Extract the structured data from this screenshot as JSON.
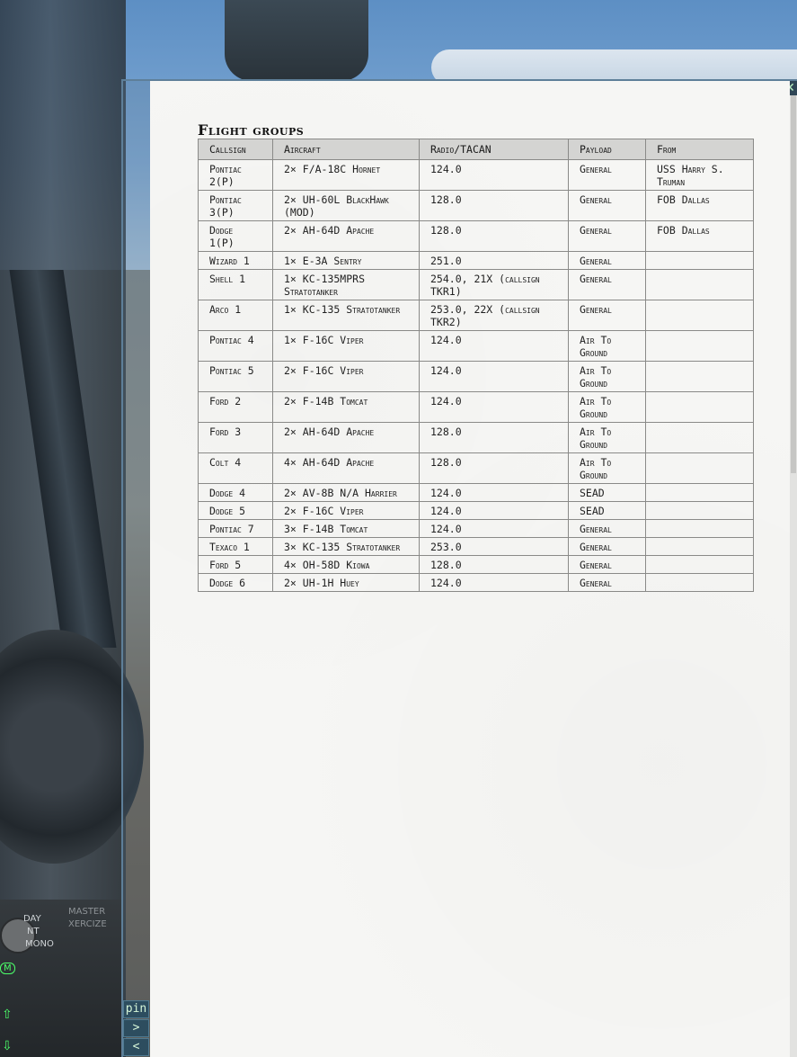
{
  "window": {
    "close_label": "✕",
    "side_buttons": [
      "pin",
      ">",
      "<"
    ]
  },
  "cockpit": {
    "panel_labels": [
      "DAY",
      "NT",
      "MONO"
    ],
    "master_label": "MASTER",
    "exercise_label": "XERCIZE",
    "indicator": "M"
  },
  "section_title": "Flight groups",
  "table": {
    "headers": [
      "Callsign",
      "Aircraft",
      "Radio/TACAN",
      "Payload",
      "From"
    ],
    "rows": [
      {
        "callsign": "Pontiac 2(P)",
        "aircraft": "2× F/A-18C Hornet",
        "radio": "124.0",
        "payload": "General",
        "from": "USS Harry S. Truman"
      },
      {
        "callsign": "Pontiac 3(P)",
        "aircraft": "2× UH-60L BlackHawk (MOD)",
        "radio": "128.0",
        "payload": "General",
        "from": "FOB Dallas"
      },
      {
        "callsign": "Dodge 1(P)",
        "aircraft": "2× AH-64D Apache",
        "radio": "128.0",
        "payload": "General",
        "from": "FOB Dallas"
      },
      {
        "callsign": "Wizard 1",
        "aircraft": "1× E-3A Sentry",
        "radio": "251.0",
        "payload": "General",
        "from": ""
      },
      {
        "callsign": "Shell 1",
        "aircraft": "1× KC-135MPRS Stratotanker",
        "radio": "254.0, 21X (callsign TKR1)",
        "payload": "General",
        "from": ""
      },
      {
        "callsign": "Arco 1",
        "aircraft": "1× KC-135 Stratotanker",
        "radio": "253.0, 22X (callsign TKR2)",
        "payload": "General",
        "from": ""
      },
      {
        "callsign": "Pontiac 4",
        "aircraft": "1× F-16C Viper",
        "radio": "124.0",
        "payload": "Air To Ground",
        "from": ""
      },
      {
        "callsign": "Pontiac 5",
        "aircraft": "2× F-16C Viper",
        "radio": "124.0",
        "payload": "Air To Ground",
        "from": ""
      },
      {
        "callsign": "Ford 2",
        "aircraft": "2× F-14B Tomcat",
        "radio": "124.0",
        "payload": "Air To Ground",
        "from": ""
      },
      {
        "callsign": "Ford 3",
        "aircraft": "2× AH-64D Apache",
        "radio": "128.0",
        "payload": "Air To Ground",
        "from": ""
      },
      {
        "callsign": "Colt 4",
        "aircraft": "4× AH-64D Apache",
        "radio": "128.0",
        "payload": "Air To Ground",
        "from": ""
      },
      {
        "callsign": "Dodge 4",
        "aircraft": "2× AV-8B N/A Harrier",
        "radio": "124.0",
        "payload": "SEAD",
        "from": ""
      },
      {
        "callsign": "Dodge 5",
        "aircraft": "2× F-16C Viper",
        "radio": "124.0",
        "payload": "SEAD",
        "from": ""
      },
      {
        "callsign": "Pontiac 7",
        "aircraft": "3× F-14B Tomcat",
        "radio": "124.0",
        "payload": "General",
        "from": ""
      },
      {
        "callsign": "Texaco 1",
        "aircraft": "3× KC-135 Stratotanker",
        "radio": "253.0",
        "payload": "General",
        "from": ""
      },
      {
        "callsign": "Ford 5",
        "aircraft": "4× OH-58D Kiowa",
        "radio": "128.0",
        "payload": "General",
        "from": ""
      },
      {
        "callsign": "Dodge 6",
        "aircraft": "2× UH-1H Huey",
        "radio": "124.0",
        "payload": "General",
        "from": ""
      }
    ]
  }
}
